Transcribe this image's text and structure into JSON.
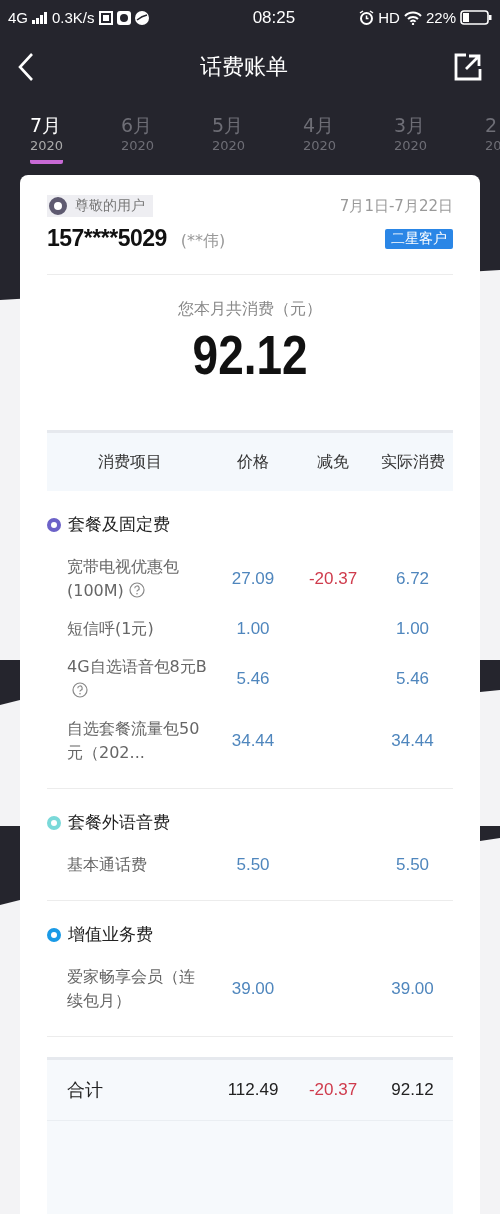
{
  "status_bar": {
    "network": "4G",
    "speed": "0.3K/s",
    "time": "08:25",
    "hd": "HD",
    "battery": "22%"
  },
  "nav": {
    "title": "话费账单"
  },
  "months": [
    {
      "month": "7月",
      "year": "2020",
      "selected": true
    },
    {
      "month": "6月",
      "year": "2020",
      "selected": false
    },
    {
      "month": "5月",
      "year": "2020",
      "selected": false
    },
    {
      "month": "4月",
      "year": "2020",
      "selected": false
    },
    {
      "month": "3月",
      "year": "2020",
      "selected": false
    },
    {
      "month": "2",
      "year": "20",
      "selected": false
    }
  ],
  "account": {
    "greeting": "尊敬的用户",
    "period": "7月1日-7月22日",
    "phone": "157****5029",
    "name": "(**伟)",
    "level_badge": "二星客户"
  },
  "summary": {
    "label": "您本月共消费（元）",
    "amount": "92.12"
  },
  "table": {
    "columns": [
      "消费项目",
      "价格",
      "减免",
      "实际消费"
    ],
    "groups": [
      {
        "title": "套餐及固定费",
        "color": "#6c62c8",
        "rows": [
          {
            "item": "宽带电视优惠包(100M)",
            "help": true,
            "price": "27.09",
            "discount": "-20.37",
            "actual": "6.72"
          },
          {
            "item": "短信呼(1元)",
            "help": false,
            "price": "1.00",
            "actual": "1.00"
          },
          {
            "item": "4G自选语音包8元B",
            "help": true,
            "price": "5.46",
            "actual": "5.46"
          },
          {
            "item": "自选套餐流量包50元（202...",
            "help": false,
            "price": "34.44",
            "actual": "34.44"
          }
        ]
      },
      {
        "title": "套餐外语音费",
        "color": "#7ad9d9",
        "rows": [
          {
            "item": "基本通话费",
            "help": false,
            "price": "5.50",
            "actual": "5.50"
          }
        ]
      },
      {
        "title": "增值业务费",
        "color": "#1a9ae6",
        "rows": [
          {
            "item": "爱家畅享会员（连续包月）",
            "help": false,
            "price": "39.00",
            "actual": "39.00"
          }
        ]
      }
    ],
    "total": {
      "label": "合计",
      "price": "112.49",
      "discount": "-20.37",
      "actual": "92.12"
    }
  }
}
